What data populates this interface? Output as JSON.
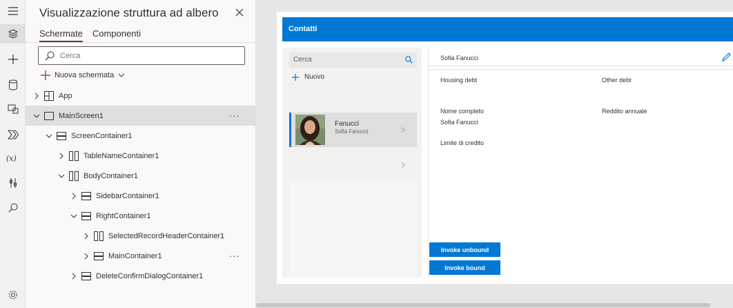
{
  "panel": {
    "title": "Visualizzazione struttura ad albero",
    "tabs": [
      "Schermate",
      "Componenti"
    ],
    "search_placeholder": "Cerca",
    "new_screen_label": "Nuova schermata"
  },
  "tree": [
    {
      "label": "App",
      "icon": "app-icon"
    },
    {
      "label": "MainScreen1",
      "icon": "screen-icon",
      "selected": true
    },
    {
      "label": "ScreenContainer1",
      "icon": "vertical-container-icon"
    },
    {
      "label": "TableNameContainer1",
      "icon": "horizontal-container-icon"
    },
    {
      "label": "BodyContainer1",
      "icon": "horizontal-container-icon"
    },
    {
      "label": "SidebarContainer1",
      "icon": "vertical-container-icon"
    },
    {
      "label": "RightContainer1",
      "icon": "vertical-container-icon"
    },
    {
      "label": "SelectedRecordHeaderContainer1",
      "icon": "horizontal-container-icon"
    },
    {
      "label": "MainContainer1",
      "icon": "vertical-container-icon"
    },
    {
      "label": "DeleteConfirmDialogContainer1",
      "icon": "vertical-container-icon"
    }
  ],
  "more_label": "···",
  "app": {
    "header_title": "Contatti",
    "search_placeholder": "Cerca",
    "new_label": "Nuovo",
    "record": {
      "name": "Fanucci",
      "subtitle": "Sofia Fanucci"
    },
    "selected_name": "Sofia Fanucci",
    "fields": {
      "housing_debt": "Housing debt",
      "other_debt": "Other debt",
      "full_name_label": "Nome completo",
      "full_name_value": "Sofia Fanucci",
      "annual_income": "Reddito annuale",
      "credit_limit": "Limite di credito"
    },
    "buttons": {
      "invoke_unbound": "Invoke unbound",
      "invoke_bound": "Invoke bound"
    }
  },
  "colors": {
    "accent": "#0078d4",
    "tab_underline": "#742774"
  }
}
